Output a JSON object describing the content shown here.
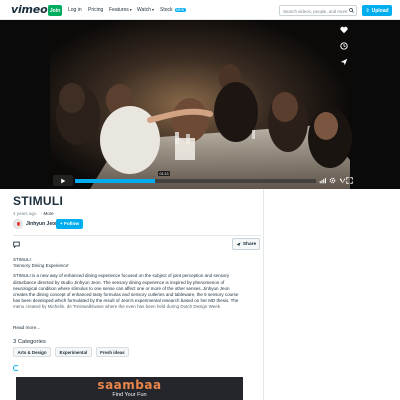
{
  "nav": {
    "logo": "vimeo",
    "join_label": "Join",
    "login_label": "Log in",
    "pricing_label": "Pricing",
    "features_label": "Features",
    "watch_label": "Watch",
    "stock_label": "Stock",
    "stock_badge": "NEW",
    "search_placeholder": "Search videos, people, and more",
    "upload_label": "Upload"
  },
  "player": {
    "time": "01:13",
    "progress": 0.33,
    "accent": "#00adef"
  },
  "video": {
    "title": "STIMULI",
    "age": "4 years ago",
    "more_label": "More",
    "author": "Jinhyun Jeon",
    "follow_label": "+ Follow",
    "share_label": "Share"
  },
  "description": {
    "line1": "STIMULI",
    "line2": "'Sensory Dining Experience'",
    "body": "STIMULI is a new way of enhanced dining experience focused on the subject of joint perception and sensory disturbance directed by studio Jinhyun Jeon. The sensory dining experience is inspired by phenomenon of neurological condition where stimulus to one sense can affect one or more of the other senses. Jinhyun Jeon creates the dining concept of enhanced tasty formulas and sensory cutleries and tableware, the 5 sensory course has been developed which formulated by the result of Jeon's experimental research based on her MD thesis. The menu created by Michelin, de Treinwalk/wave where the even has been held during Dutch Design Week.",
    "read_more": "Read more..."
  },
  "categories": {
    "title": "3 Categories",
    "items": [
      "Arts & Design",
      "Experimental",
      "Fresh ideas"
    ]
  },
  "ad": {
    "brand": "saambaa",
    "tagline": "Find Your Fun",
    "brand_color": "#e9854a"
  },
  "colors": {
    "join": "#00ad5f",
    "accent": "#00adef",
    "text": "#1a2e3b"
  }
}
